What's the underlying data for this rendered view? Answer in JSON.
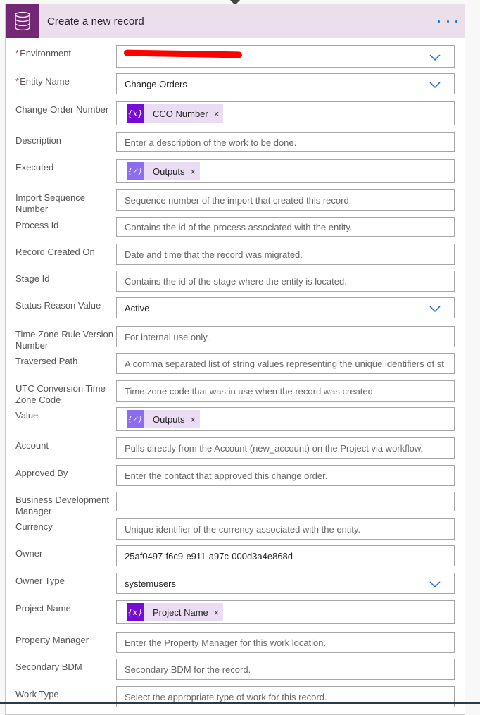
{
  "card": {
    "title": "Create a new record",
    "icon": "database-icon",
    "more_icon": "more-options-icon"
  },
  "colors": {
    "header_bg": "#ebdfeb",
    "icon_bg": "#742774",
    "accent_blue": "#0f6ad8",
    "required_red": "#d13438",
    "token_variable": "#770bd6",
    "token_output": "#8c6cf0",
    "token_bg": "#eadcf3"
  },
  "fields": [
    {
      "label": "Environment",
      "required": true,
      "type": "dropdown",
      "value": "",
      "redacted": true
    },
    {
      "label": "Entity Name",
      "required": true,
      "type": "dropdown",
      "value": "Change Orders"
    },
    {
      "label": "Change Order Number",
      "type": "token",
      "token": {
        "kind": "variable",
        "icon": "{x}",
        "label": "CCO Number",
        "close": "×"
      }
    },
    {
      "label": "Description",
      "type": "text",
      "placeholder": "Enter a description of the work to be done."
    },
    {
      "label": "Executed",
      "type": "token",
      "token": {
        "kind": "output",
        "icon": "{✓}",
        "label": "Outputs",
        "close": "×"
      }
    },
    {
      "label": "Import Sequence Number",
      "type": "text",
      "placeholder": "Sequence number of the import that created this record."
    },
    {
      "label": "Process Id",
      "type": "text",
      "placeholder": "Contains the id of the process associated with the entity."
    },
    {
      "label": "Record Created On",
      "type": "text",
      "placeholder": "Date and time that the record was migrated."
    },
    {
      "label": "Stage Id",
      "type": "text",
      "placeholder": "Contains the id of the stage where the entity is located."
    },
    {
      "label": "Status Reason Value",
      "type": "dropdown",
      "value": "Active"
    },
    {
      "label": "Time Zone Rule Version Number",
      "type": "text",
      "placeholder": "For internal use only."
    },
    {
      "label": "Traversed Path",
      "type": "text",
      "placeholder": "A comma separated list of string values representing the unique identifiers of st"
    },
    {
      "label": "UTC Conversion Time Zone Code",
      "type": "text",
      "placeholder": "Time zone code that was in use when the record was created."
    },
    {
      "label": "Value",
      "type": "token",
      "token": {
        "kind": "output",
        "icon": "{✓}",
        "label": "Outputs",
        "close": "×"
      }
    },
    {
      "label": "Account",
      "type": "text",
      "placeholder": "Pulls directly from the Account (new_account) on the Project via workflow."
    },
    {
      "label": "Approved By",
      "type": "text",
      "placeholder": "Enter the contact that approved this change order."
    },
    {
      "label": "Business Development Manager",
      "type": "text",
      "placeholder": ""
    },
    {
      "label": "Currency",
      "type": "text",
      "placeholder": "Unique identifier of the currency associated with the entity."
    },
    {
      "label": "Owner",
      "type": "text",
      "value": "25af0497-f6c9-e911-a97c-000d3a4e868d"
    },
    {
      "label": "Owner Type",
      "type": "dropdown",
      "value": "systemusers"
    },
    {
      "label": "Project Name",
      "type": "token",
      "token": {
        "kind": "variable",
        "icon": "{x}",
        "label": "Project Name",
        "close": "×"
      }
    },
    {
      "label": "Property Manager",
      "type": "text",
      "placeholder": "Enter the Property Manager for this work location."
    },
    {
      "label": "Secondary BDM",
      "type": "text",
      "placeholder": "Secondary BDM for the record."
    },
    {
      "label": "Work Type",
      "type": "text",
      "placeholder": "Select the appropriate type of work for this record."
    }
  ]
}
